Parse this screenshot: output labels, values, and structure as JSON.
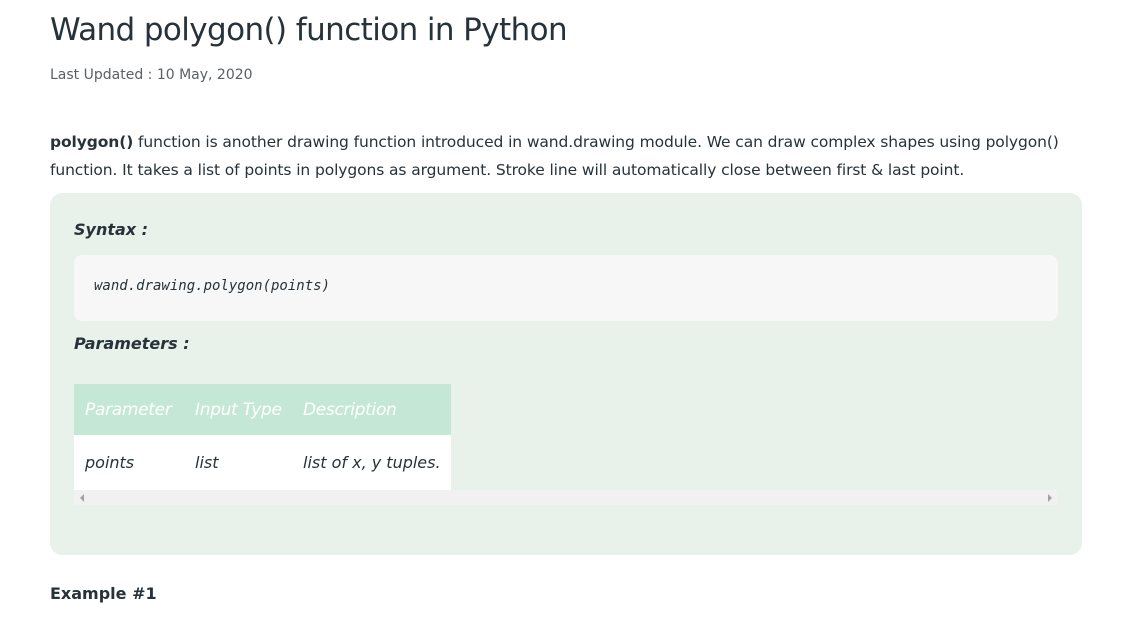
{
  "article": {
    "title": "Wand polygon() function in Python",
    "last_updated": "Last Updated : 10 May, 2020",
    "intro_bold": "polygon()",
    "intro_text": " function is another drawing function introduced in wand.drawing module. We can draw complex shapes using polygon() function. It takes a list of points in polygons as argument. Stroke line will automatically close between first & last point."
  },
  "syntax_box": {
    "syntax_label": "Syntax :",
    "syntax_code": "wand.drawing.polygon(points)",
    "parameters_label": "Parameters :",
    "table": {
      "headers": [
        "Parameter",
        "Input Type",
        "Description"
      ],
      "rows": [
        [
          "points",
          "list",
          "list of x, y tuples."
        ]
      ]
    }
  },
  "example_heading": "Example #1",
  "colors": {
    "box_background": "#e8f1ea",
    "table_header": "#c5e8d6",
    "code_background": "#f7f7f7",
    "text": "#273239"
  }
}
